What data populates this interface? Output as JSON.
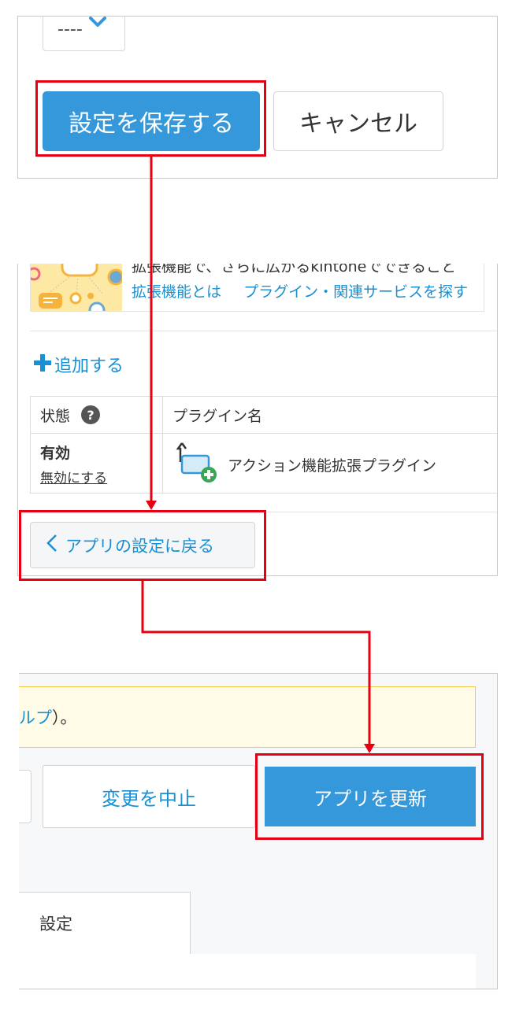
{
  "top_panel": {
    "dropdown_value": "----",
    "save_button": "設定を保存する",
    "cancel_button": "キャンセル"
  },
  "plugin_panel": {
    "banner_text": "拡張機能で、さらに広がるkintoneでできること",
    "banner_links": [
      "拡張機能とは",
      "プラグイン・関連サービスを探す"
    ],
    "add_label": "追加する",
    "table_headers": {
      "status": "状態",
      "name": "プラグイン名"
    },
    "row": {
      "status": "有効",
      "disable_link": "無効にする",
      "plugin_name": "アクション機能拡張プラグイン"
    },
    "back_button": "アプリの設定に戻る"
  },
  "app_panel": {
    "notice_link": "ルプ",
    "notice_rest": "）。",
    "discard_button": "変更を中止",
    "update_button": "アプリを更新",
    "tab_label": "設定"
  },
  "colors": {
    "primary": "#3498db",
    "link": "#1a8fd1",
    "highlight": "#e60012",
    "notice_bg": "#fffbe6",
    "notice_border": "#f2c84b"
  }
}
